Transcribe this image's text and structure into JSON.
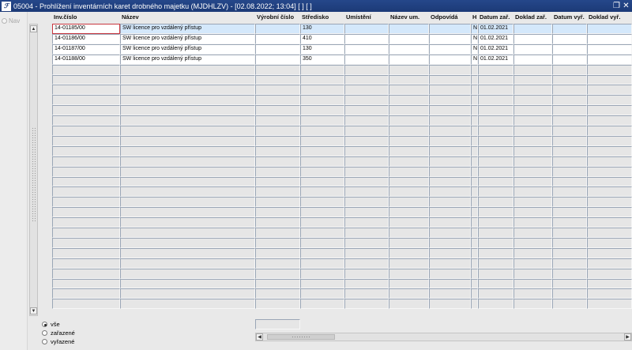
{
  "window": {
    "title": "05004 - Prohlížení inventárních karet drobného majetku (MJDHLZV) - [02.08.2022; 13:04]  [ ] [ ]",
    "icon": "app-logo-icon"
  },
  "nav": {
    "label": "Nav"
  },
  "columns": [
    "Inv.číslo",
    "Název",
    "Výrobní číslo",
    "Středisko",
    "Umístění",
    "Název um.",
    "Odpovídá",
    "H",
    "Datum zař.",
    "Doklad zař.",
    "Datum vyř.",
    "Doklad vyř."
  ],
  "rows": [
    [
      "14-01185/00",
      "SW licence pro vzdálený přístup",
      "",
      "130",
      "",
      "",
      "",
      "N",
      "01.02.2021",
      "",
      "",
      ""
    ],
    [
      "14-01186/00",
      "SW licence pro vzdálený přístup",
      "",
      "410",
      "",
      "",
      "",
      "N",
      "01.02.2021",
      "",
      "",
      ""
    ],
    [
      "14-01187/00",
      "SW licence pro vzdálený přístup",
      "",
      "130",
      "",
      "",
      "",
      "N",
      "01.02.2021",
      "",
      "",
      ""
    ],
    [
      "14-01188/00",
      "SW licence pro vzdálený přístup",
      "",
      "350",
      "",
      "",
      "",
      "N",
      "01.02.2021",
      "",
      "",
      ""
    ]
  ],
  "empty_rows": 24,
  "filter": {
    "options": [
      "vše",
      "zařazené",
      "vyřazené"
    ],
    "selected": "vše"
  }
}
